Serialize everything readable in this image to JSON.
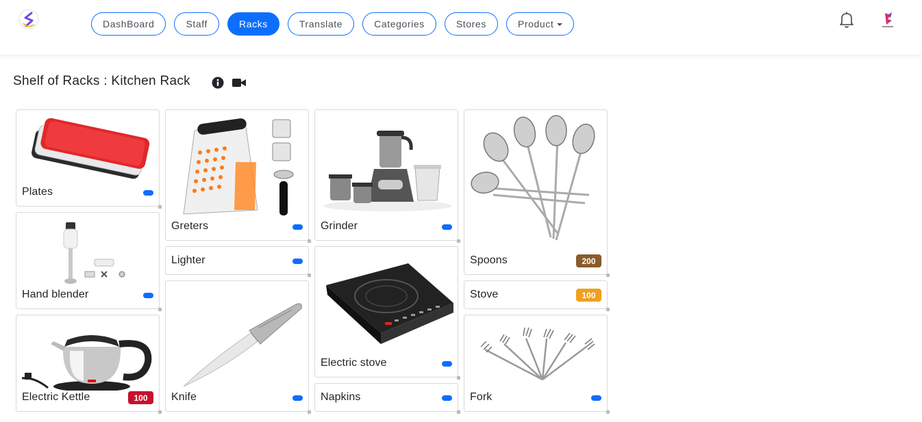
{
  "nav": {
    "items": [
      {
        "label": "DashBoard",
        "active": false
      },
      {
        "label": "Staff",
        "active": false
      },
      {
        "label": "Racks",
        "active": true
      },
      {
        "label": "Translate",
        "active": false
      },
      {
        "label": "Categories",
        "active": false
      },
      {
        "label": "Stores",
        "active": false
      },
      {
        "label": "Product",
        "active": false,
        "dropdown": true
      }
    ]
  },
  "page": {
    "title": "Shelf of Racks : Kitchen Rack",
    "icons": [
      "info-icon",
      "video-camera-icon"
    ]
  },
  "racks": {
    "plates": {
      "label": "Plates",
      "badge": ""
    },
    "hand_blender": {
      "label": "Hand blender",
      "badge": ""
    },
    "electric_kettle": {
      "label": "Electric Kettle",
      "badge": "100",
      "badge_color": "#c8102e"
    },
    "greters": {
      "label": "Greters",
      "badge": ""
    },
    "lighter": {
      "label": "Lighter",
      "badge": ""
    },
    "knife": {
      "label": "Knife",
      "badge": ""
    },
    "grinder": {
      "label": "Grinder",
      "badge": ""
    },
    "electric_stove": {
      "label": "Electric stove",
      "badge": ""
    },
    "napkins": {
      "label": "Napkins",
      "badge": ""
    },
    "spoons": {
      "label": "Spoons",
      "badge": "200",
      "badge_color": "#8a5a2b"
    },
    "stove": {
      "label": "Stove",
      "badge": "100",
      "badge_color": "#f0a020"
    },
    "fork": {
      "label": "Fork",
      "badge": ""
    }
  },
  "colors": {
    "accent": "#0d6efd"
  }
}
